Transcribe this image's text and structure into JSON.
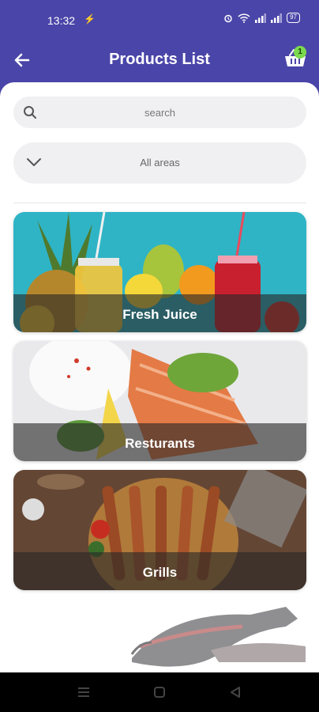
{
  "status_bar": {
    "time": "13:32",
    "battery": "97"
  },
  "header": {
    "title": "Products List",
    "cart_badge_count": "1"
  },
  "search": {
    "placeholder": "search"
  },
  "area_filter": {
    "selected": "All areas"
  },
  "categories": [
    {
      "label": "Fresh Juice"
    },
    {
      "label": "Resturants"
    },
    {
      "label": "Grills"
    },
    {
      "label": ""
    }
  ],
  "colors": {
    "brand": "#4a45a8",
    "badge": "#7bd94e"
  }
}
